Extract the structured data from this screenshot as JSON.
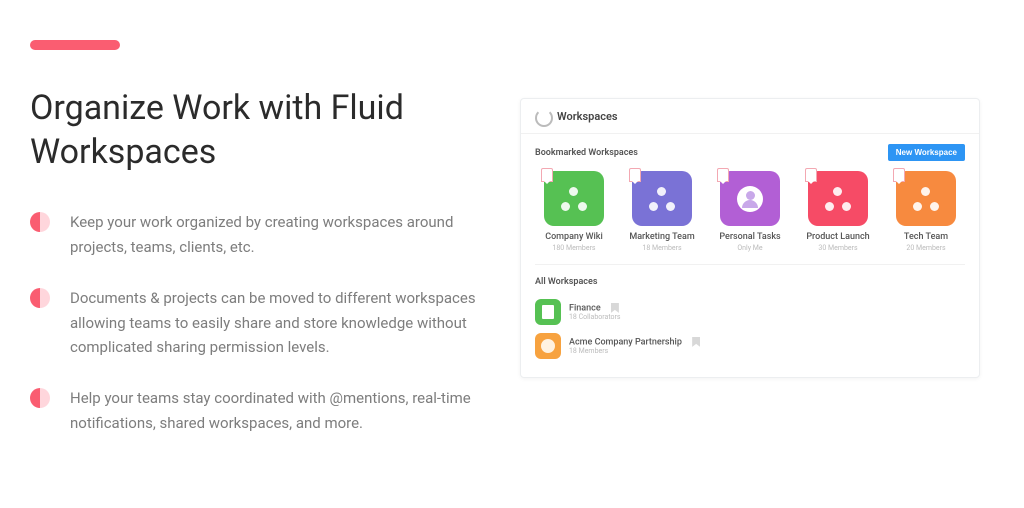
{
  "heading": "Organize Work with Fluid Workspaces",
  "bullets": [
    "Keep your work organized by creating workspaces around projects, teams, clients, etc.",
    "Documents & projects can be moved to different workspaces allowing teams to easily share and store knowledge without complicated sharing permission levels.",
    "Help your teams stay coordinated with @mentions, real-time notifications, shared workspaces, and more."
  ],
  "panel": {
    "title": "Workspaces",
    "bookmarked_heading": "Bookmarked Workspaces",
    "new_button": "New Workspace",
    "cards": [
      {
        "title": "Company Wiki",
        "sub": "180 Members",
        "color": "#56c153",
        "type": "dots"
      },
      {
        "title": "Marketing Team",
        "sub": "18 Members",
        "color": "#7a72d6",
        "type": "dots"
      },
      {
        "title": "Personal Tasks",
        "sub": "Only Me",
        "color": "#b25fd5",
        "type": "avatar"
      },
      {
        "title": "Product Launch",
        "sub": "30 Members",
        "color": "#f64b66",
        "type": "dots"
      },
      {
        "title": "Tech Team",
        "sub": "20 Members",
        "color": "#f78a3f",
        "type": "dots"
      }
    ],
    "all_heading": "All Workspaces",
    "list": [
      {
        "title": "Finance",
        "sub": "18 Collaborators",
        "color": "#56c153",
        "icon": "doc"
      },
      {
        "title": "Acme Company Partnership",
        "sub": "18 Members",
        "color": "#f7a23f",
        "icon": "circle"
      }
    ]
  }
}
